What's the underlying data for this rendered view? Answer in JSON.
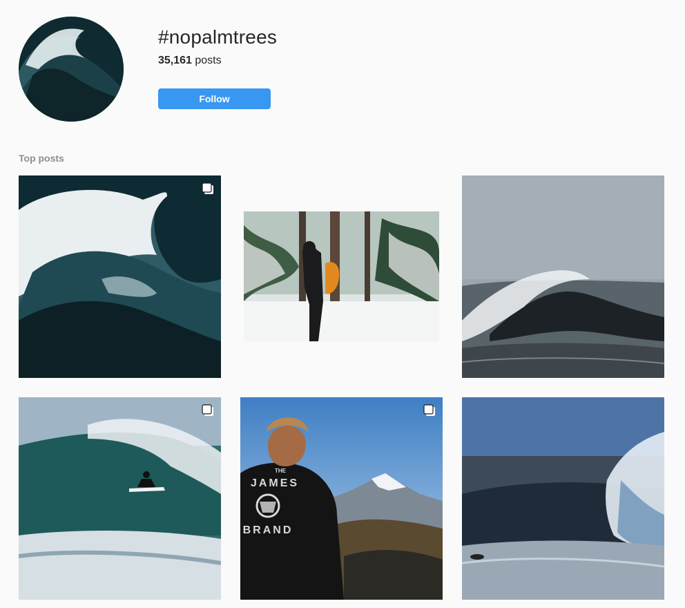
{
  "header": {
    "hashtag": "#nopalmtrees",
    "post_count": "35,161",
    "post_count_suffix": " posts",
    "follow_label": "Follow",
    "avatar_alt": "Hashtag profile image of crashing wave"
  },
  "top_posts": {
    "label": "Top posts",
    "items": [
      {
        "alt": "Crashing dark ocean wave",
        "multi": true
      },
      {
        "alt": "Surfer in wetsuit carrying orange board through snowy forest",
        "multi": false
      },
      {
        "alt": "Breaking wave on grey sea",
        "multi": false
      },
      {
        "alt": "Surfer riding inside a barrel wave",
        "multi": true
      },
      {
        "alt": "Man in black t-shirt facing mountains",
        "multi": true
      },
      {
        "alt": "Large wave breaking with surfer paddling",
        "multi": false
      }
    ],
    "shirt_text_top": "THE",
    "shirt_text_mid": "JAMES",
    "shirt_text_bottom": "BRAND"
  },
  "colors": {
    "accent": "#3897f0",
    "background": "#fafafa",
    "muted_text": "#8e8e8e"
  },
  "icons": {
    "multi_post": "carousel-icon"
  }
}
